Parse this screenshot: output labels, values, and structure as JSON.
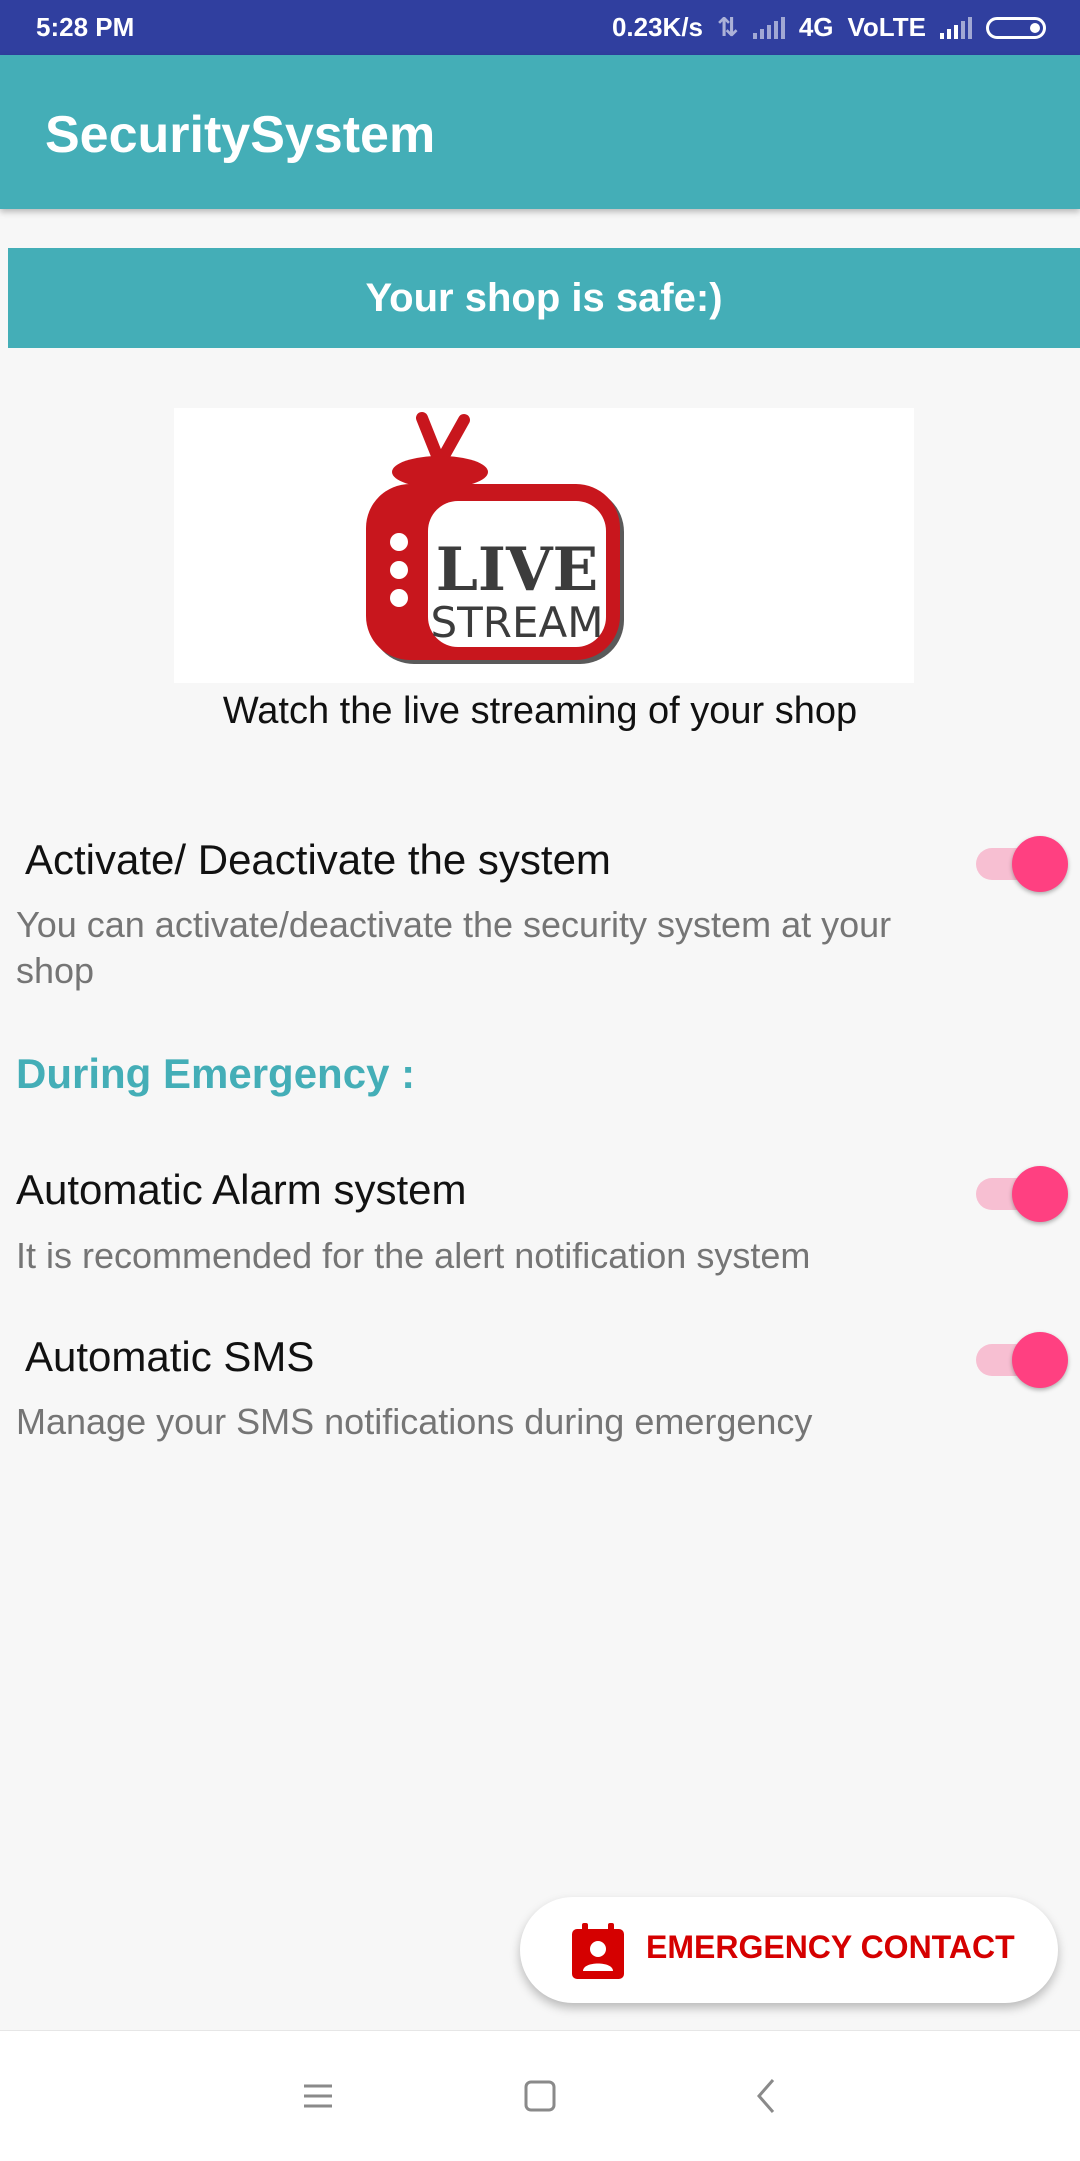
{
  "status_bar": {
    "time": "5:28 PM",
    "net_speed": "0.23K/s",
    "network": "4G",
    "volte": "VoLTE"
  },
  "app_bar": {
    "title": "SecuritySystem"
  },
  "banner": {
    "text": "Your shop is safe:)"
  },
  "live_stream": {
    "logo_line1": "LIVE",
    "logo_line2": "STREAM",
    "caption": "Watch the live streaming of your shop"
  },
  "settings": {
    "activate": {
      "title": "Activate/ Deactivate the system",
      "description": "You can activate/deactivate the security system at your shop",
      "enabled": true
    },
    "section_label": "During Emergency :",
    "alarm": {
      "title": "Automatic Alarm system",
      "description": "It is recommended for the alert notification system",
      "enabled": true
    },
    "sms": {
      "title": "Automatic SMS",
      "description": "Manage your SMS notifications during emergency",
      "enabled": true
    }
  },
  "emergency_button": {
    "label": "EMERGENCY CONTACT",
    "icon": "contact-calendar-icon"
  },
  "nav_bar": {
    "icons": [
      "menu-icon",
      "home-icon",
      "back-icon"
    ]
  },
  "colors": {
    "status_bar": "#303f9f",
    "primary": "#44aeb7",
    "accent": "#ff4081",
    "emergency": "#d50000"
  }
}
